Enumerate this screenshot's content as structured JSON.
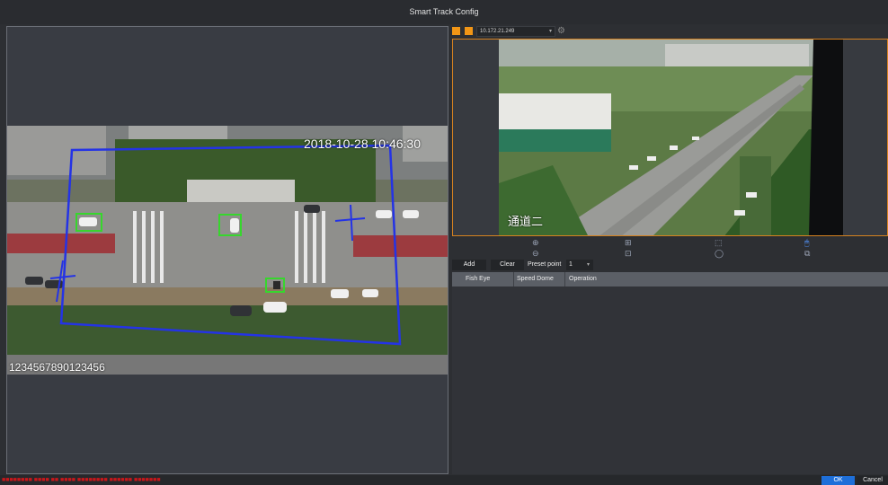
{
  "window": {
    "title": "Smart Track Config"
  },
  "fisheye": {
    "timestamp": "2018-10-28 10:46:30",
    "channel_text": "1234567890123456"
  },
  "device": {
    "ip": "10.172.21.249"
  },
  "speed_dome": {
    "overlay_text": "通道二"
  },
  "ptz": {
    "zoom_in": "⊕",
    "zoom_out": "⊖",
    "focus_near": "⊞",
    "focus_far": "⊡",
    "iris_open": "⬚",
    "iris_close": "◯",
    "mouse": "🖱",
    "track": "⧉"
  },
  "toolbar": {
    "add_label": "Add",
    "clear_label": "Clear",
    "preset_label": "Preset point",
    "preset_value": "1"
  },
  "table": {
    "headers": [
      "Fish Eye",
      "Speed Dome",
      "Operation"
    ],
    "rows": []
  },
  "footer": {
    "warning": "■■■■■■■■ ■■■■ ■■ ■■■■ ■■■■■■■■ ■■■■■■ ■■■■■■■",
    "ok_label": "OK",
    "cancel_label": "Cancel"
  },
  "colors": {
    "accent": "#1e6fd9",
    "warning": "#c8171b",
    "brand": "#f29616"
  }
}
